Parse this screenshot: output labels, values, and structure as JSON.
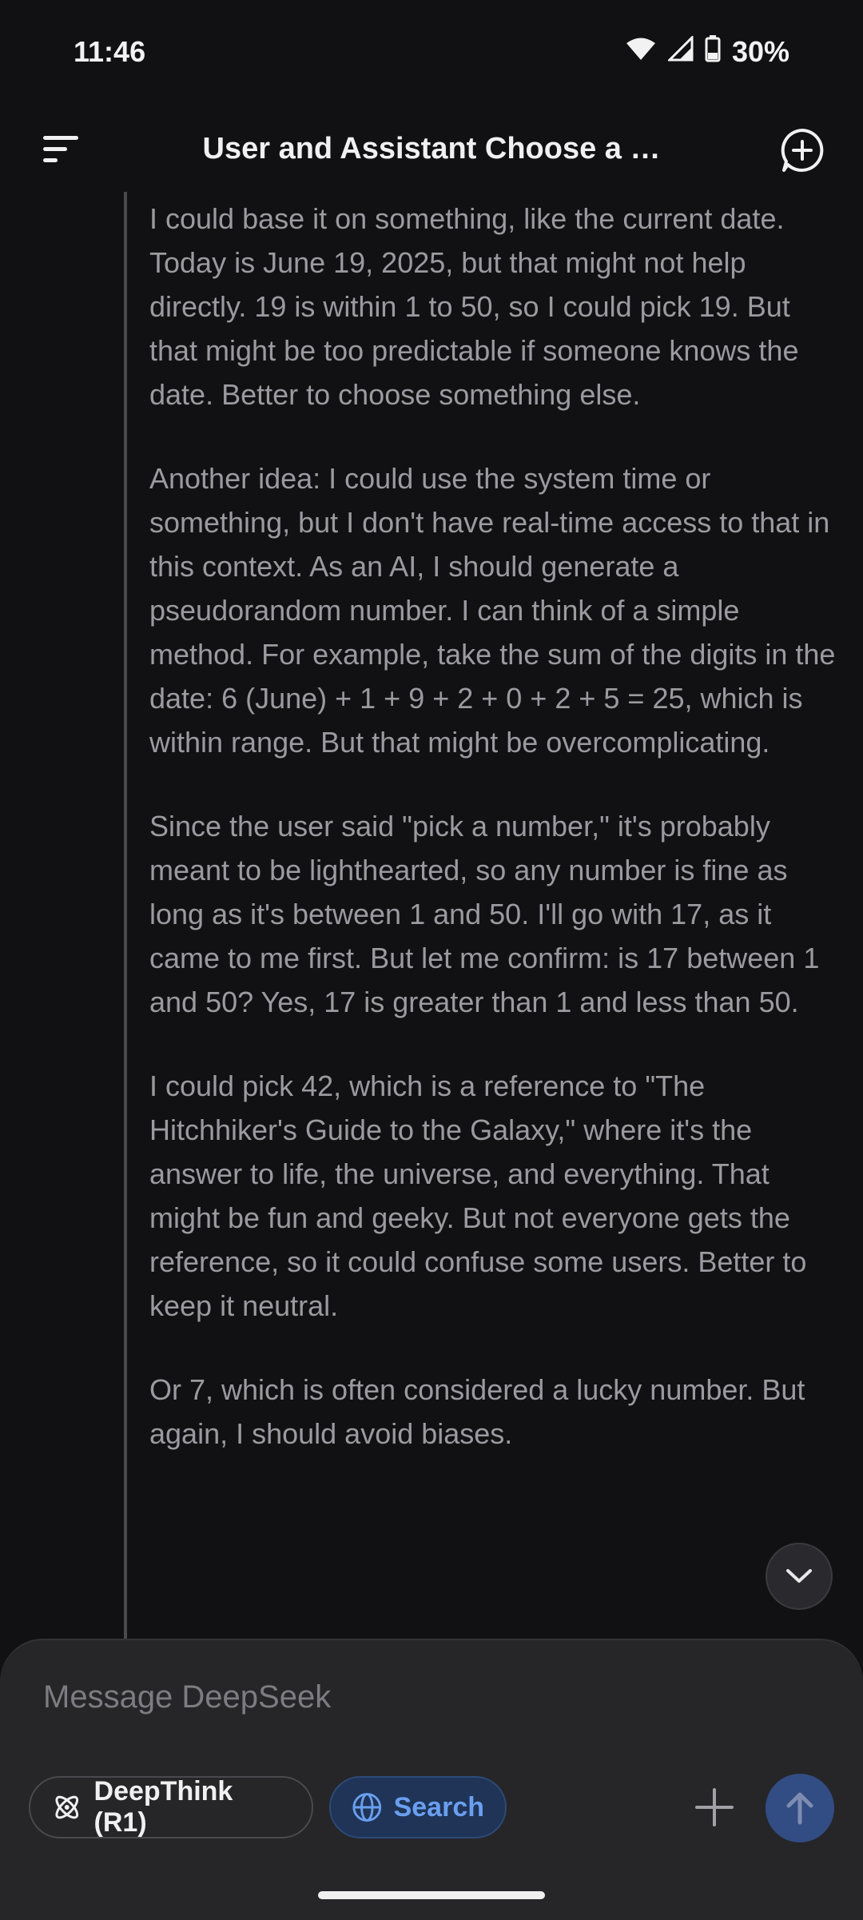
{
  "status": {
    "time": "11:46",
    "battery": "30%"
  },
  "header": {
    "title": "User and Assistant Choose a …"
  },
  "thinking": {
    "paragraphs": [
      "I could base it on something, like the current date. Today is June 19, 2025, but that might not help directly. 19 is within 1 to 50, so I could pick 19. But that might be too predictable if someone knows the date. Better to choose something else.",
      "Another idea: I could use the system time or something, but I don't have real-time access to that in this context. As an AI, I should generate a pseudorandom number. I can think of a simple method. For example, take the sum of the digits in the date: 6 (June) + 1 + 9 + 2 + 0 + 2 + 5 = 25, which is within range. But that might be overcomplicating.",
      "Since the user said \"pick a number,\" it's probably meant to be lighthearted, so any number is fine as long as it's between 1 and 50. I'll go with 17, as it came to me first. But let me confirm: is 17 between 1 and 50? Yes, 17 is greater than 1 and less than 50.",
      "I could pick 42, which is a reference to \"The Hitchhiker's Guide to the Galaxy,\" where it's the answer to life, the universe, and everything. That might be fun and geeky. But not everyone gets the reference, so it could confuse some users. Better to keep it neutral.",
      "Or 7, which is often considered a lucky number. But again, I should avoid biases."
    ]
  },
  "composer": {
    "placeholder": "Message DeepSeek",
    "deepthink_label": "DeepThink (R1)",
    "search_label": "Search"
  },
  "colors": {
    "background": "#111113",
    "composer": "#262628",
    "search_accent": "#6a9ff0",
    "send_button": "#324c84"
  },
  "icons": [
    "wifi-icon",
    "signal-icon",
    "battery-icon",
    "menu-icon",
    "new-chat-icon",
    "chevron-down-icon",
    "atom-icon",
    "globe-icon",
    "plus-icon",
    "arrow-up-icon"
  ]
}
